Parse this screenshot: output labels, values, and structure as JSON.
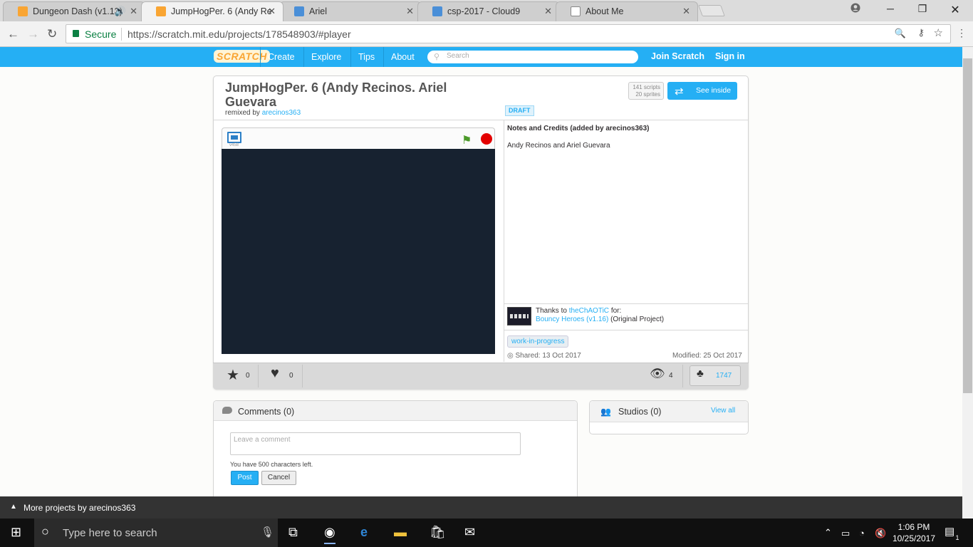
{
  "browser": {
    "tabs": [
      {
        "title": "Dungeon Dash (v1.13)",
        "active": false
      },
      {
        "title": "JumpHogPer. 6 (Andy Re",
        "active": true
      },
      {
        "title": "Ariel",
        "active": false
      },
      {
        "title": "csp-2017 - Cloud9",
        "active": false
      },
      {
        "title": "About Me",
        "active": false
      }
    ],
    "secure_label": "Secure",
    "url": "https://scratch.mit.edu/projects/178548903/#player"
  },
  "nav": {
    "logo": "SCRATCH",
    "links": [
      "Create",
      "Explore",
      "Tips",
      "About"
    ],
    "search_placeholder": "Search",
    "join": "Join Scratch",
    "signin": "Sign in"
  },
  "project": {
    "title": "JumpHogPer. 6 (Andy Recinos. Ariel Guevara",
    "remixed_by_label": "remixed by",
    "author": "arecinos363",
    "scripts": "141 scripts",
    "sprites": "20 sprites",
    "see_inside": "See inside",
    "draft": "DRAFT",
    "player_version": "v458",
    "notes_title": "Notes and Credits (added by arecinos363)",
    "notes_body": "Andy Recinos and Ariel Guevara",
    "thanks_prefix": "Thanks to",
    "thanks_user": "theChAOTiC",
    "thanks_for": "for:",
    "original_project": "Bouncy Heroes (v1.16)",
    "original_suffix": "(Original Project)",
    "tag": "work-in-progress",
    "shared": "Shared: 13 Oct 2017",
    "modified": "Modified: 25 Oct 2017",
    "favorites": "0",
    "loves": "0",
    "views": "4",
    "remixes": "1747"
  },
  "comments": {
    "title": "Comments (0)",
    "placeholder": "Leave a comment",
    "chars_left": "You have 500 characters left.",
    "post": "Post",
    "cancel": "Cancel"
  },
  "studios": {
    "title": "Studios (0)",
    "view_all": "View all"
  },
  "more_projects": "More projects by arecinos363",
  "taskbar": {
    "search_placeholder": "Type here to search",
    "time": "1:06 PM",
    "date": "10/25/2017",
    "notifications": "1"
  },
  "colors": {
    "scratch_blue": "#25aff4",
    "stage": "#172230"
  }
}
